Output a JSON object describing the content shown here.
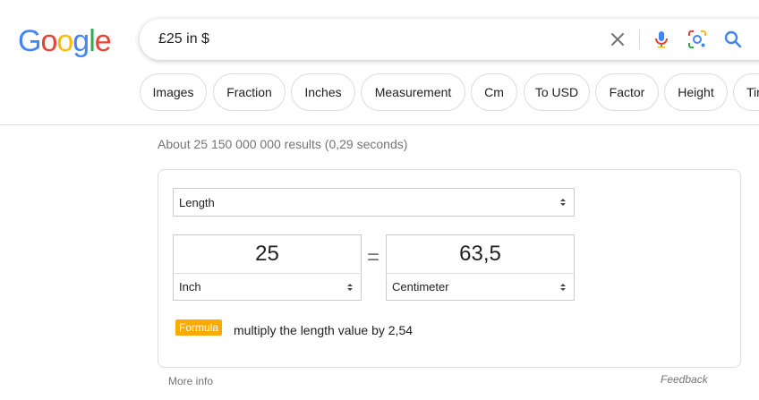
{
  "logo": {
    "text": "Google",
    "colors": [
      "#4285F4",
      "#EA4335",
      "#FBBC05",
      "#4285F4",
      "#34A853",
      "#EA4335"
    ]
  },
  "search": {
    "query": "£25 in $",
    "icons": [
      "close-icon",
      "microphone-icon",
      "lens-icon",
      "search-icon"
    ]
  },
  "chips": [
    {
      "label": "Images"
    },
    {
      "label": "Fraction"
    },
    {
      "label": "Inches"
    },
    {
      "label": "Measurement"
    },
    {
      "label": "Cm"
    },
    {
      "label": "To USD"
    },
    {
      "label": "Factor"
    },
    {
      "label": "Height"
    },
    {
      "label": "Tir"
    }
  ],
  "results": {
    "stats": "About 25 150 000 000 results (0,29 seconds)"
  },
  "converter": {
    "category": "Length",
    "from_value": "25",
    "to_value": "63,5",
    "equals": "=",
    "from_unit": "Inch",
    "to_unit": "Centimeter",
    "formula_label": "Formula",
    "formula_text": "multiply the length value by 2,54",
    "accent": "#f9ab00"
  },
  "footer": {
    "more_info": "More info",
    "feedback": "Feedback"
  }
}
